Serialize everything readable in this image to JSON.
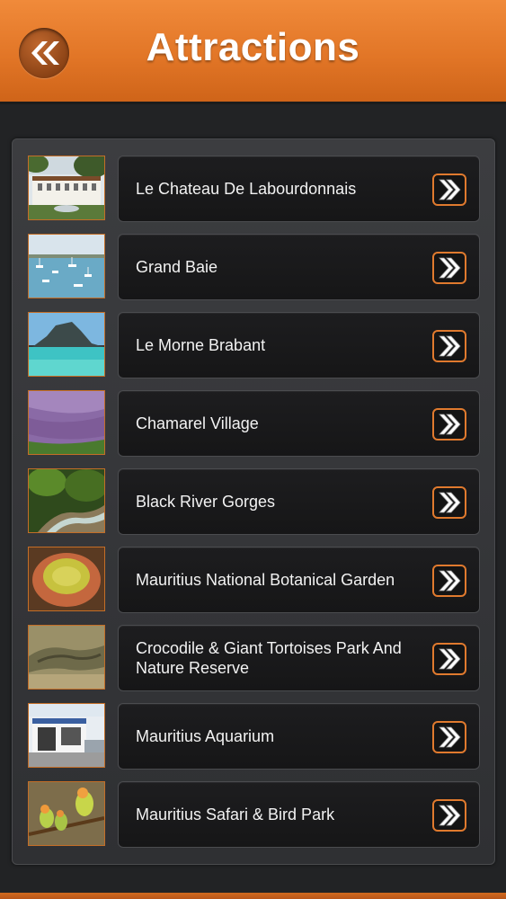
{
  "header": {
    "title": "Attractions",
    "back_icon": "double-chevron-left-icon",
    "accent_color": "#e27627"
  },
  "items": [
    {
      "label": "Le Chateau De Labourdonnais",
      "thumb": "chateau-photo"
    },
    {
      "label": "Grand Baie",
      "thumb": "bay-boats-photo"
    },
    {
      "label": "Le Morne Brabant",
      "thumb": "mountain-lagoon-photo"
    },
    {
      "label": "Chamarel Village",
      "thumb": "colored-earth-photo"
    },
    {
      "label": "Black River Gorges",
      "thumb": "forest-river-photo"
    },
    {
      "label": "Mauritius National Botanical Garden",
      "thumb": "waterlily-photo"
    },
    {
      "label": "Crocodile & Giant Tortoises Park And Nature Reserve",
      "thumb": "crocodile-photo"
    },
    {
      "label": "Mauritius Aquarium",
      "thumb": "aquarium-building-photo"
    },
    {
      "label": "Mauritius Safari & Bird Park",
      "thumb": "parrots-photo"
    }
  ]
}
